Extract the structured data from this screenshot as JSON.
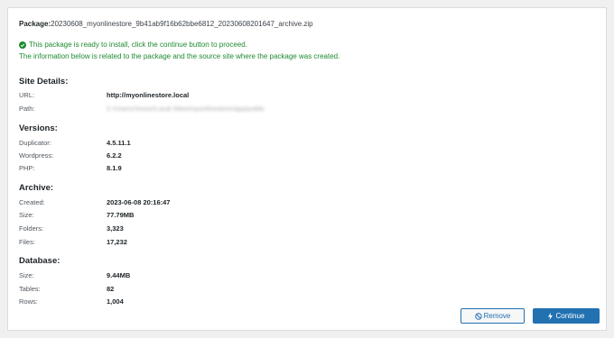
{
  "package": {
    "label": "Package:",
    "filename": "20230608_myonlinestore_9b41ab9f16b62bbe6812_20230608201647_archive.zip"
  },
  "notice": {
    "line1": "This package is ready to install, click the continue button to proceed.",
    "line2": "The information below is related to the package and the source site where the package was created.",
    "color": "#1e8b2f"
  },
  "site_details": {
    "heading": "Site Details:",
    "url_label": "URL:",
    "url_value": "http://myonlinestore.local",
    "path_label": "Path:",
    "path_value": "C:/Users/Xxxxx/Local Sites/myonlinestore/app/public"
  },
  "versions": {
    "heading": "Versions:",
    "duplicator_label": "Duplicator:",
    "duplicator_value": "4.5.11.1",
    "wordpress_label": "Wordpress:",
    "wordpress_value": "6.2.2",
    "php_label": "PHP:",
    "php_value": "8.1.9"
  },
  "archive": {
    "heading": "Archive:",
    "created_label": "Created:",
    "created_value": "2023-06-08 20:16:47",
    "size_label": "Size:",
    "size_value": "77.79MB",
    "folders_label": "Folders:",
    "folders_value": "3,323",
    "files_label": "Files:",
    "files_value": "17,232"
  },
  "database": {
    "heading": "Database:",
    "size_label": "Size:",
    "size_value": "9.44MB",
    "tables_label": "Tables:",
    "tables_value": "82",
    "rows_label": "Rows:",
    "rows_value": "1,004"
  },
  "buttons": {
    "remove_label": "Remove",
    "remove_icon": "ban-icon",
    "continue_label": "Continue",
    "continue_icon": "bolt-icon",
    "accent": "#2271b1"
  }
}
